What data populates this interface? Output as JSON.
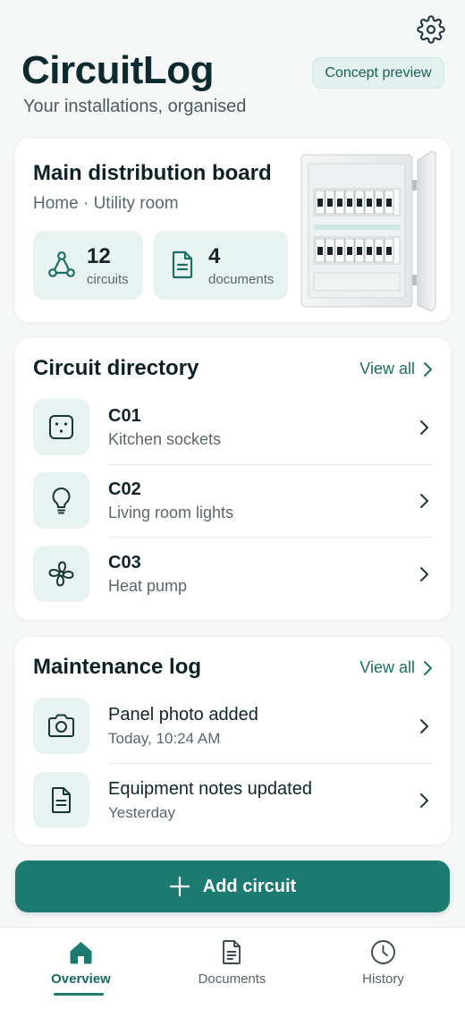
{
  "header": {
    "app_title": "CircuitLog",
    "subtitle": "Your installations, organised",
    "chip_label": "Concept preview",
    "settings_icon": "gear-icon"
  },
  "board": {
    "title": "Main distribution board",
    "location": "Home · Utility room",
    "stats": [
      {
        "value": "12",
        "label": "circuits",
        "icon": "circuit-network-icon"
      },
      {
        "value": "4",
        "label": "documents",
        "icon": "document-icon"
      }
    ],
    "image": "distribution-panel-image"
  },
  "circuit_directory": {
    "title": "Circuit directory",
    "view_all": "View all",
    "items": [
      {
        "code": "C01",
        "name": "Kitchen sockets",
        "icon": "socket-icon"
      },
      {
        "code": "C02",
        "name": "Living room lights",
        "icon": "lightbulb-icon"
      },
      {
        "code": "C03",
        "name": "Heat pump",
        "icon": "fan-icon"
      }
    ]
  },
  "maintenance_log": {
    "title": "Maintenance log",
    "view_all": "View all",
    "items": [
      {
        "title": "Panel photo added",
        "time": "Today, 10:24 AM",
        "icon": "camera-icon"
      },
      {
        "title": "Equipment notes updated",
        "time": "Yesterday",
        "icon": "document-icon"
      }
    ]
  },
  "add_button": {
    "label": "Add circuit",
    "icon": "plus-icon"
  },
  "nav": {
    "active": "Overview",
    "items": [
      {
        "label": "Overview",
        "icon": "home-icon"
      },
      {
        "label": "Documents",
        "icon": "document-icon"
      },
      {
        "label": "History",
        "icon": "clock-icon"
      }
    ]
  },
  "colors": {
    "accent": "#1c7a70",
    "accent_light": "#e8f3f1",
    "background": "#f6f7f7",
    "text_primary": "#12232b",
    "text_secondary": "#5a676b"
  }
}
